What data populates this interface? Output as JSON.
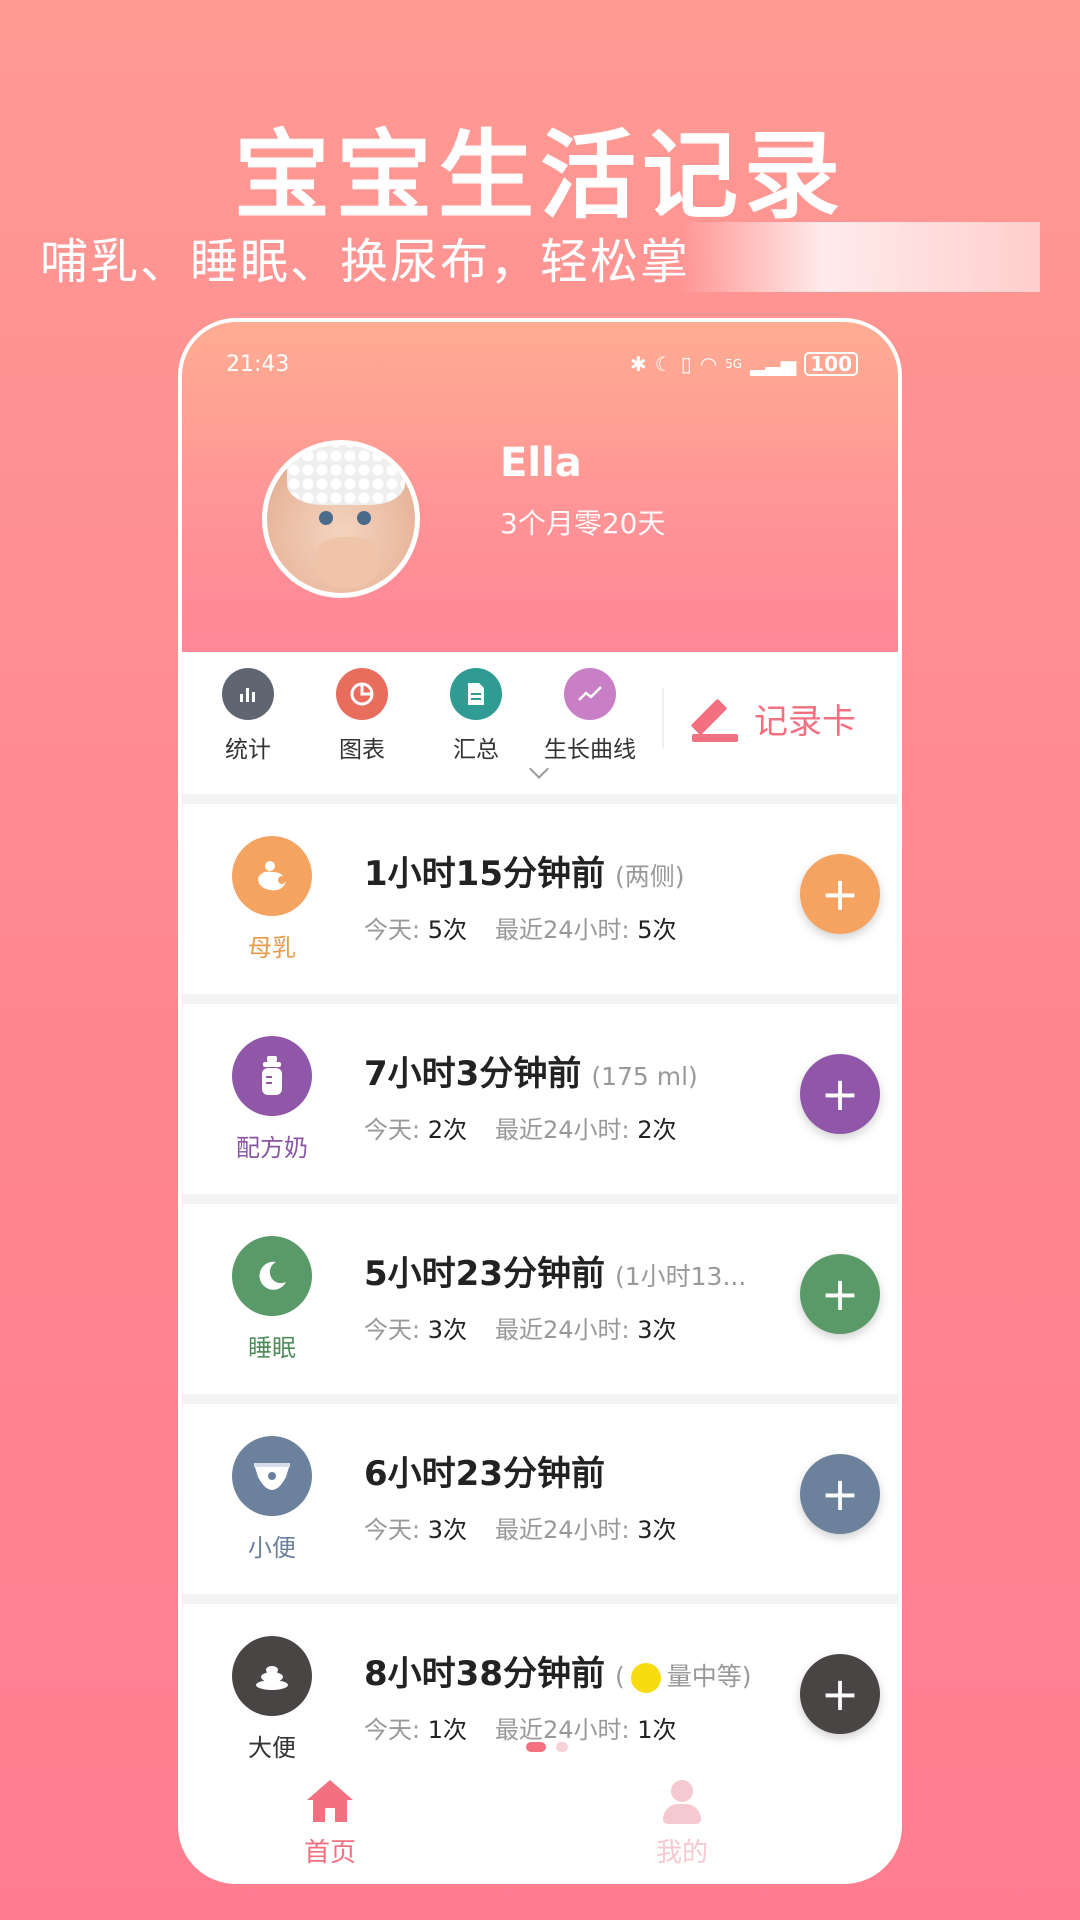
{
  "promo": {
    "title": "宝宝生活记录",
    "subtitle": "哺乳、睡眠、换尿布，轻松掌"
  },
  "status_bar": {
    "time": "21:43",
    "battery": "100",
    "network": "5G"
  },
  "profile": {
    "name": "Ella",
    "age": "3个月零20天"
  },
  "toolbar": {
    "items": [
      {
        "label": "统计",
        "icon": "bar-chart-icon",
        "color": "#5f6672"
      },
      {
        "label": "图表",
        "icon": "pie-chart-icon",
        "color": "#e96d5c"
      },
      {
        "label": "汇总",
        "icon": "document-icon",
        "color": "#2f9b93"
      },
      {
        "label": "生长曲线",
        "icon": "trend-icon",
        "color": "#c97fc6"
      }
    ],
    "record_card_label": "记录卡"
  },
  "cards": [
    {
      "category": "母乳",
      "icon": "breastfeed-icon",
      "color": "#f4a460",
      "label_color": "#e79a4b",
      "title": "1小时15分钟前",
      "extra": "(两侧)",
      "today_label": "今天:",
      "today": "5次",
      "recent_label": "最近24小时:",
      "recent": "5次"
    },
    {
      "category": "配方奶",
      "icon": "bottle-icon",
      "color": "#9057a8",
      "label_color": "#8a55a2",
      "title": "7小时3分钟前",
      "extra": "(175 ml)",
      "today_label": "今天:",
      "today": "2次",
      "recent_label": "最近24小时:",
      "recent": "2次"
    },
    {
      "category": "睡眠",
      "icon": "moon-icon",
      "color": "#5a9a68",
      "label_color": "#4f8d5d",
      "title": "5小时23分钟前",
      "extra": "(1小时13...",
      "today_label": "今天:",
      "today": "3次",
      "recent_label": "最近24小时:",
      "recent": "3次"
    },
    {
      "category": "小便",
      "icon": "diaper-icon",
      "color": "#6b819c",
      "label_color": "#6b819c",
      "title": "6小时23分钟前",
      "extra": "",
      "today_label": "今天:",
      "today": "3次",
      "recent_label": "最近24小时:",
      "recent": "3次"
    },
    {
      "category": "大便",
      "icon": "poop-icon",
      "color": "#4a4545",
      "label_color": "#333333",
      "title": "8小时38分钟前",
      "extra_prefix": "(",
      "extra": "量中等)",
      "today_label": "今天:",
      "today": "1次",
      "recent_label": "最近24小时:",
      "recent": "1次"
    }
  ],
  "tabs": [
    {
      "label": "首页",
      "icon": "home-icon",
      "active": true
    },
    {
      "label": "我的",
      "icon": "user-icon",
      "active": false
    }
  ],
  "colors": {
    "accent": "#f2707f",
    "inactive_tab": "#f5c9d0"
  }
}
